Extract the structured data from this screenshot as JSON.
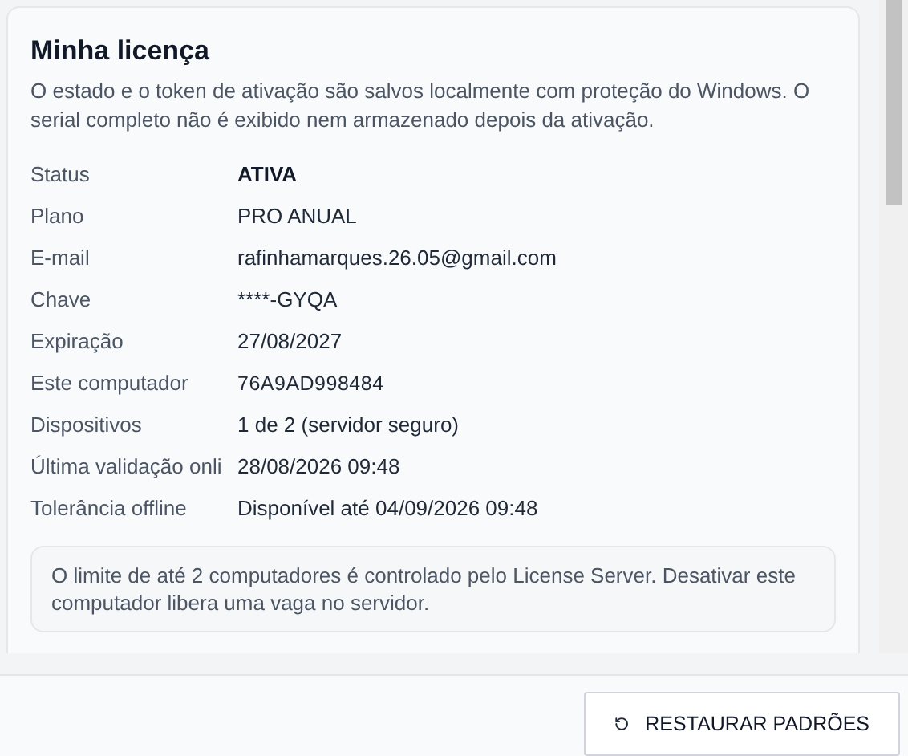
{
  "card": {
    "title": "Minha licença",
    "description": "O estado e o token de ativação são salvos localmente com proteção do Windows. O serial completo não é exibido nem armazenado depois da ativação.",
    "rows": [
      {
        "label": "Status",
        "value": "ATIVA",
        "kind": "status"
      },
      {
        "label": "Plano",
        "value": "PRO ANUAL",
        "kind": "text"
      },
      {
        "label": "E-mail",
        "value": "rafinhamarques.26.05@gmail.com",
        "kind": "text"
      },
      {
        "label": "Chave",
        "value": "****-GYQA",
        "kind": "text"
      },
      {
        "label": "Expiração",
        "value": "27/08/2027",
        "kind": "text"
      },
      {
        "label": "Este computador",
        "value": "76A9AD998484",
        "kind": "code"
      },
      {
        "label": "Dispositivos",
        "value": "1 de 2 (servidor seguro)",
        "kind": "text"
      },
      {
        "label": "Última validação onli",
        "value": "28/08/2026 09:48",
        "kind": "text"
      },
      {
        "label": "Tolerância offline",
        "value": "Disponível até 04/09/2026 09:48",
        "kind": "text"
      }
    ],
    "note": "O limite de até 2 computadores é controlado pelo License Server. Desativar este computador libera uma vaga no servidor."
  },
  "footer": {
    "button": "RESTAURAR PADRÕES"
  }
}
